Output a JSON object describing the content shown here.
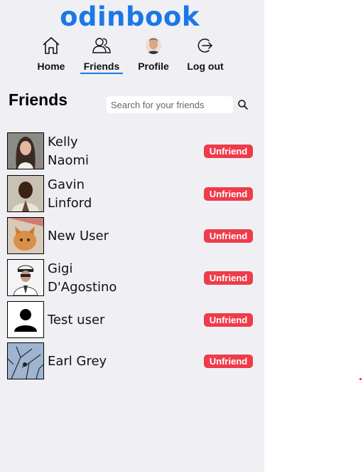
{
  "app": {
    "logo": "odinbook"
  },
  "nav": {
    "items": [
      {
        "label": "Home",
        "icon": "home-icon"
      },
      {
        "label": "Friends",
        "icon": "friends-icon",
        "active": true
      },
      {
        "label": "Profile",
        "icon": "avatar"
      },
      {
        "label": "Log out",
        "icon": "logout-icon"
      }
    ]
  },
  "page": {
    "title": "Friends"
  },
  "search": {
    "placeholder": "Search for your friends",
    "value": ""
  },
  "friends": [
    {
      "name_line1": "Kelly",
      "name_line2": "Naomi",
      "action": "Unfriend"
    },
    {
      "name_line1": "Gavin",
      "name_line2": "Linford",
      "action": "Unfriend"
    },
    {
      "name_line1": "New User",
      "name_line2": "",
      "action": "Unfriend"
    },
    {
      "name_line1": "Gigi",
      "name_line2": "D'Agostino",
      "action": "Unfriend"
    },
    {
      "name_line1": "Test user",
      "name_line2": "",
      "action": "Unfriend"
    },
    {
      "name_line1": "Earl Grey",
      "name_line2": "",
      "action": "Unfriend"
    }
  ],
  "colors": {
    "brand": "#1a78e6",
    "danger": "#ef3b4a",
    "panel": "#f0f0f4"
  }
}
